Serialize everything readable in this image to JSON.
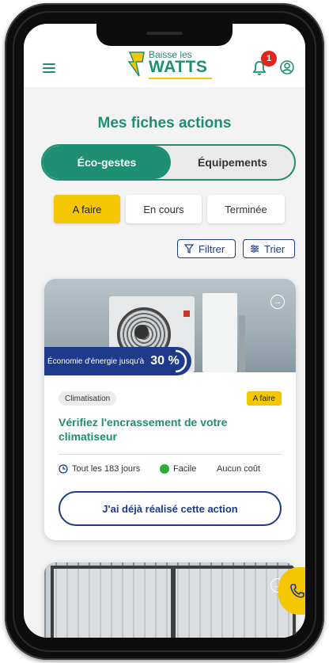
{
  "header": {
    "logo_small": "Baisse les",
    "logo_big": "WATTS",
    "notification_count": "1"
  },
  "page_title": "Mes fiches actions",
  "tabs": {
    "active": "Éco-gestes",
    "other": "Équipements"
  },
  "status_filters": [
    "A faire",
    "En cours",
    "Terminée"
  ],
  "tools": {
    "filter_label": "Filtrer",
    "sort_label": "Trier"
  },
  "card": {
    "savings_label": "Économie d'énergie jusqu'à",
    "savings_value": "30 %",
    "category": "Climatisation",
    "state": "A faire",
    "title": "Vérifiez l'encrassement de votre climatiseur",
    "frequency": "Tout les 183 jours",
    "difficulty": "Facile",
    "cost": "Aucun coût",
    "button_label": "J'ai déjà réalisé cette action"
  },
  "colors": {
    "green": "#1e8f73",
    "navy": "#1e3a8a",
    "yellow": "#f6c700",
    "red": "#e2261c"
  }
}
